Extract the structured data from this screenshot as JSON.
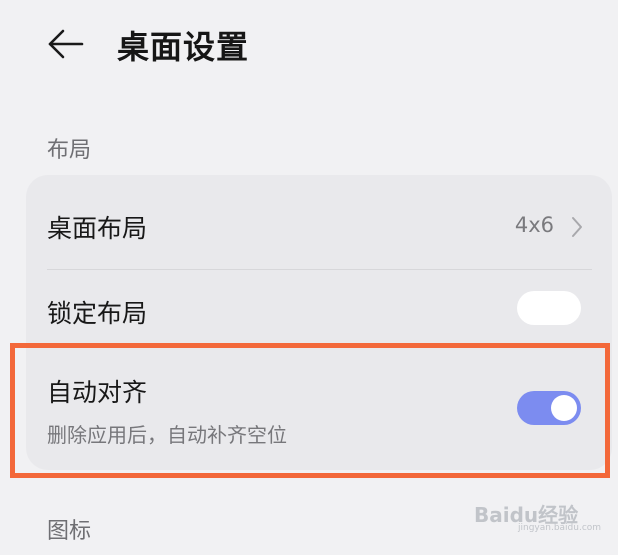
{
  "header": {
    "title": "桌面设置"
  },
  "sections": {
    "layout_label": "布局",
    "icon_label": "图标"
  },
  "rows": {
    "desktop_layout": {
      "label": "桌面布局",
      "value": "4x6"
    },
    "lock_layout": {
      "label": "锁定布局",
      "enabled": false
    },
    "auto_align": {
      "label": "自动对齐",
      "description": "删除应用后，自动补齐空位",
      "enabled": true
    }
  },
  "colors": {
    "toggle_on": "#7c8cf0",
    "highlight": "#f3683a"
  },
  "watermark": {
    "text": "Baidu经验",
    "sub": "jingyan.baidu.com"
  }
}
